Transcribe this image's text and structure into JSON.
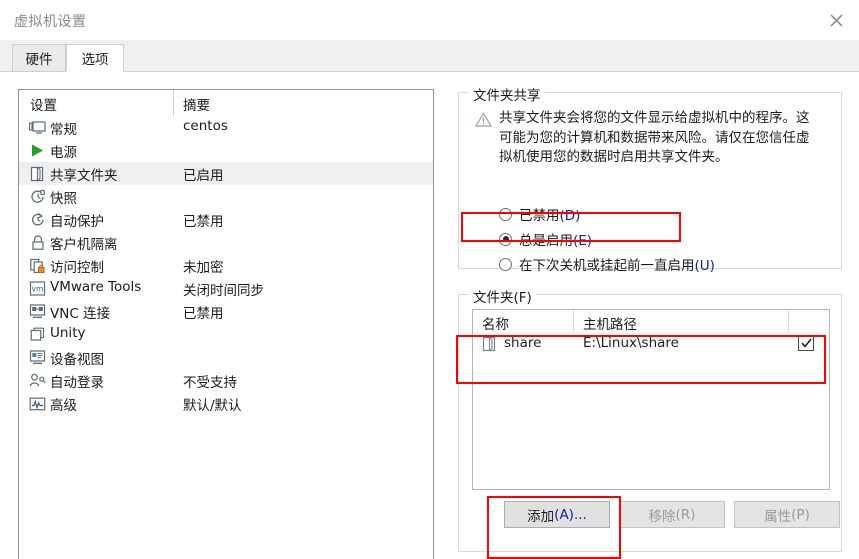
{
  "window": {
    "title": "虚拟机设置",
    "close_icon": "close-icon"
  },
  "tabs": [
    {
      "label": "硬件",
      "active": false
    },
    {
      "label": "选项",
      "active": true
    }
  ],
  "settings_list": {
    "columns": {
      "name": "设置",
      "summary": "摘要"
    },
    "items": [
      {
        "icon": "monitor-icon",
        "label": "常规",
        "summary": "centos",
        "selected": false
      },
      {
        "icon": "power-play-icon",
        "label": "电源",
        "summary": "",
        "selected": false
      },
      {
        "icon": "shared-folder-icon",
        "label": "共享文件夹",
        "summary": "已启用",
        "selected": true
      },
      {
        "icon": "snapshot-icon",
        "label": "快照",
        "summary": "",
        "selected": false
      },
      {
        "icon": "autoprotect-icon",
        "label": "自动保护",
        "summary": "已禁用",
        "selected": false
      },
      {
        "icon": "lock-icon",
        "label": "客户机隔离",
        "summary": "",
        "selected": false
      },
      {
        "icon": "access-control-icon",
        "label": "访问控制",
        "summary": "未加密",
        "selected": false
      },
      {
        "icon": "vmware-tools-icon",
        "label": "VMware Tools",
        "summary": "关闭时间同步",
        "selected": false
      },
      {
        "icon": "vnc-icon",
        "label": "VNC 连接",
        "summary": "已禁用",
        "selected": false
      },
      {
        "icon": "unity-icon",
        "label": "Unity",
        "summary": "",
        "selected": false
      },
      {
        "icon": "device-view-icon",
        "label": "设备视图",
        "summary": "",
        "selected": false
      },
      {
        "icon": "auto-login-icon",
        "label": "自动登录",
        "summary": "不受支持",
        "selected": false
      },
      {
        "icon": "advanced-icon",
        "label": "高级",
        "summary": "默认/默认",
        "selected": false
      }
    ]
  },
  "folder_sharing": {
    "group_title": "文件夹共享",
    "warning_icon": "warning-triangle-icon",
    "warning_text": "共享文件夹会将您的文件显示给虚拟机中的程序。这可能为您的计算机和数据带来风险。请仅在您信任虚拟机使用您的数据时启用共享文件夹。",
    "options": [
      {
        "label": "已禁用",
        "accel": "(D)",
        "selected": false
      },
      {
        "label": "总是启用",
        "accel": "(E)",
        "selected": true
      },
      {
        "label": "在下次关机或挂起前一直启用",
        "accel": "(U)",
        "selected": false
      }
    ]
  },
  "folders": {
    "group_title": "文件夹(F)",
    "columns": {
      "name": "名称",
      "path": "主机路径",
      "enabled": ""
    },
    "rows": [
      {
        "icon": "folder-icon",
        "name": "share",
        "path": "E:\\Linux\\share",
        "enabled": true,
        "check_icon": "check-icon"
      }
    ],
    "buttons": [
      {
        "label": "添加",
        "accel": "(A)...",
        "enabled": true
      },
      {
        "label": "移除",
        "accel": "(R)",
        "enabled": false
      },
      {
        "label": "属性",
        "accel": "(P)",
        "enabled": false
      }
    ]
  },
  "annotations": {
    "color": "#ff0000",
    "boxes": [
      {
        "name": "always-enabled-radio-highlight"
      },
      {
        "name": "share-folder-row-highlight"
      },
      {
        "name": "add-button-highlight"
      }
    ]
  }
}
